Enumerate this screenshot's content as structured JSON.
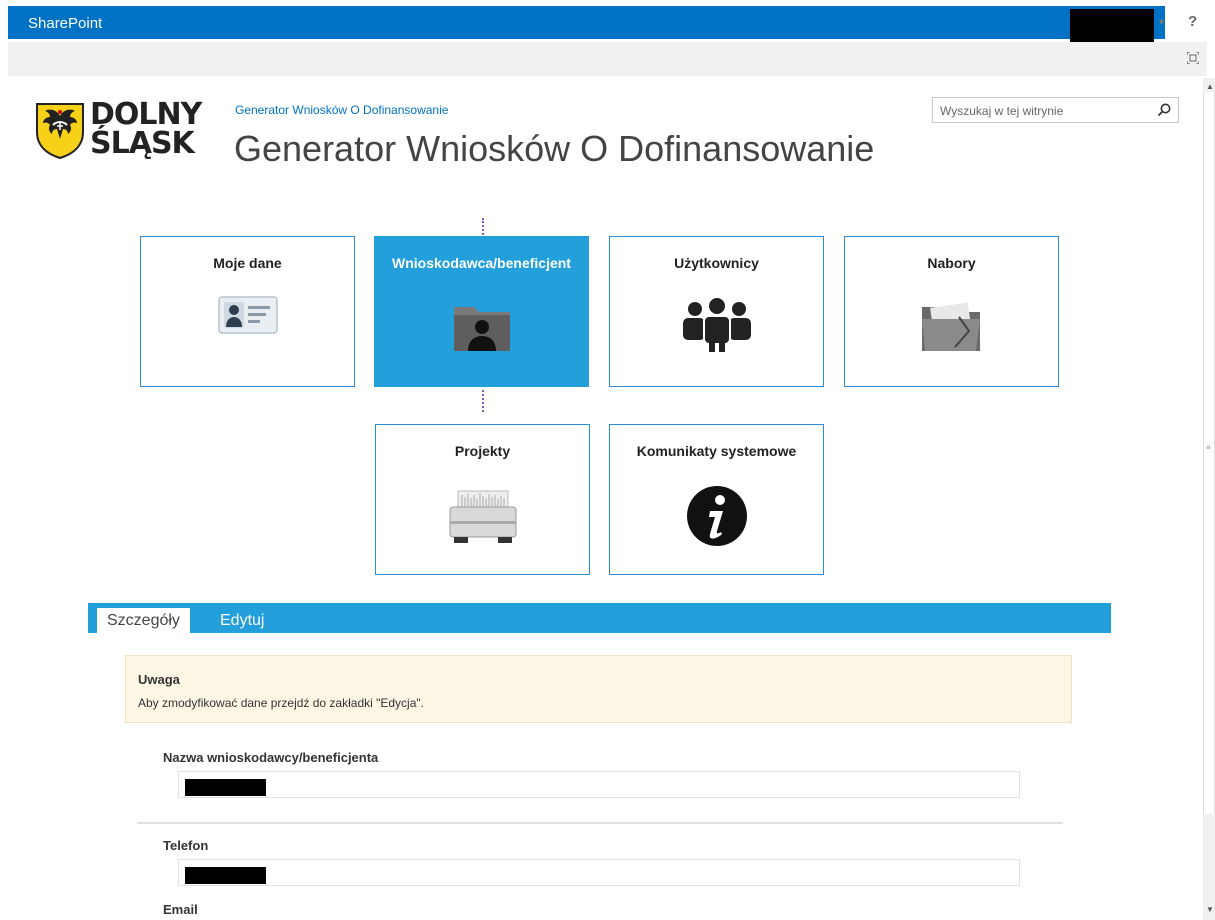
{
  "topbar": {
    "brand": "SharePoint",
    "help": "?"
  },
  "logo": {
    "line1": "DOLNY",
    "line2": "ŚLĄSK"
  },
  "header": {
    "breadcrumb": "Generator Wniosków O Dofinansowanie",
    "title": "Generator Wniosków O Dofinansowanie"
  },
  "search": {
    "placeholder": "Wyszukaj w tej witrynie"
  },
  "tiles": [
    {
      "label": "Moje dane",
      "icon": "id-card-icon"
    },
    {
      "label": "Wnioskodawca/beneficjent",
      "icon": "user-folder-icon",
      "active": true
    },
    {
      "label": "Użytkownicy",
      "icon": "users-group-icon"
    },
    {
      "label": "Nabory",
      "icon": "document-folder-icon"
    },
    {
      "label": "Projekty",
      "icon": "filing-tray-icon"
    },
    {
      "label": "Komunikaty systemowe",
      "icon": "info-icon"
    }
  ],
  "tabs": [
    {
      "label": "Szczegóły",
      "selected": true
    },
    {
      "label": "Edytuj",
      "selected": false
    }
  ],
  "notice": {
    "title": "Uwaga",
    "message": "Aby zmodyfikować dane przejdź do zakładki \"Edycja\"."
  },
  "fields": [
    {
      "label": "Nazwa wnioskodawcy/beneficjenta"
    },
    {
      "label": "Telefon"
    },
    {
      "label": "Email"
    }
  ],
  "colors": {
    "brand_blue": "#0072c6",
    "tile_blue": "#239fdb",
    "notice_bg": "#fdf6e5"
  }
}
